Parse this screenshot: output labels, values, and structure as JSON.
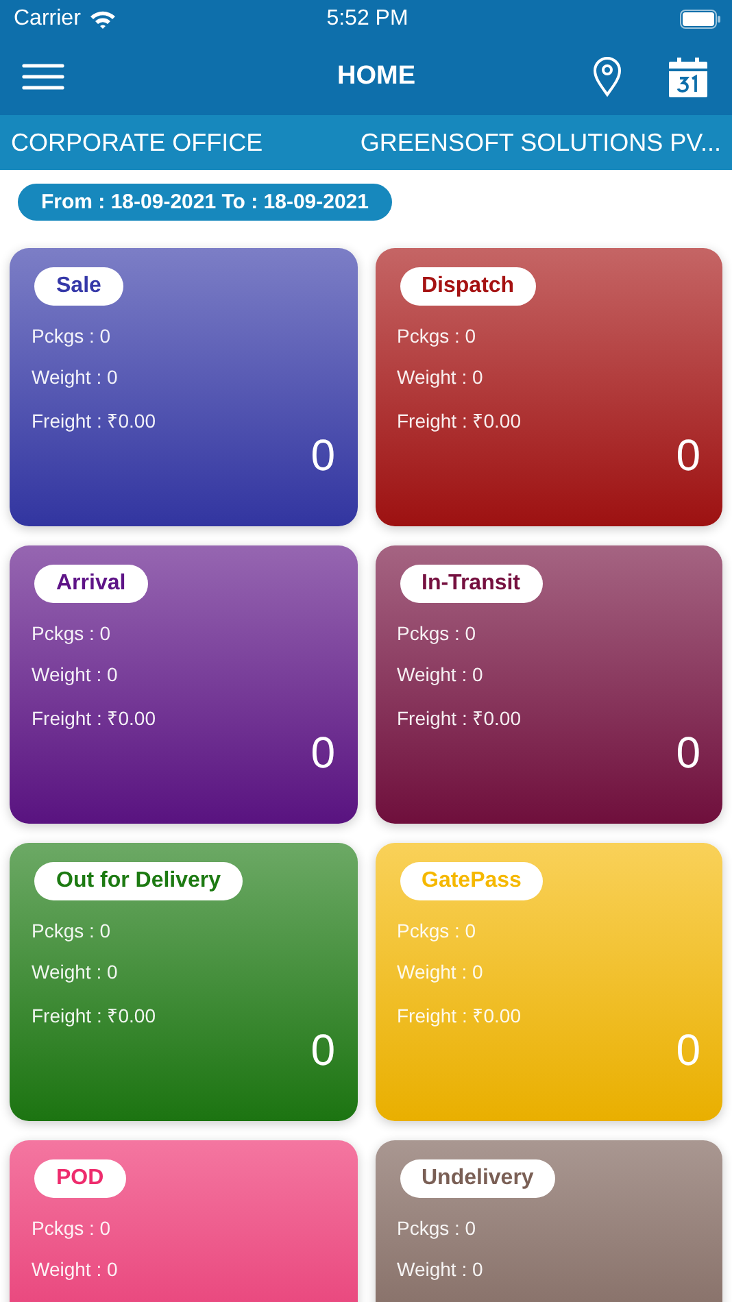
{
  "status_bar": {
    "carrier": "Carrier",
    "time": "5:52 PM"
  },
  "nav_bar": {
    "title": "HOME"
  },
  "branch_bar": {
    "branch": "CORPORATE OFFICE",
    "company": "GREENSOFT SOLUTIONS PV..."
  },
  "date_range": "From : 18-09-2021 To : 18-09-2021",
  "cards": [
    {
      "label": "Sale",
      "color": "#3538a8",
      "lines": [
        "Pckgs : 0",
        "Weight : 0",
        "Freight : ₹0.00"
      ],
      "count": "0"
    },
    {
      "label": "Dispatch",
      "color": "#a51212",
      "lines": [
        "Pckgs : 0",
        "Weight : 0",
        "Freight : ₹0.00"
      ],
      "count": "0"
    },
    {
      "label": "Arrival",
      "color": "#5e1487",
      "lines": [
        "Pckgs : 0",
        "Weight : 0",
        "Freight : ₹0.00"
      ],
      "count": "0"
    },
    {
      "label": "In-Transit",
      "color": "#75103f",
      "lines": [
        "Pckgs : 0",
        "Weight : 0",
        "Freight : ₹0.00"
      ],
      "count": "0"
    },
    {
      "label": "Out for Delivery",
      "color": "#1d7a12",
      "lines": [
        "Pckgs : 0",
        "Weight : 0",
        "Freight : ₹0.00"
      ],
      "count": "0"
    },
    {
      "label": "GatePass",
      "color": "#f5b800",
      "lines": [
        "Pckgs : 0",
        "Weight : 0",
        "Freight : ₹0.00"
      ],
      "count": "0"
    },
    {
      "label": "POD",
      "color": "#ee2c6d",
      "lines": [
        "Pckgs : 0",
        "Weight : 0"
      ]
    },
    {
      "label": "Undelivery",
      "color": "#7a5f55",
      "lines": [
        "Pckgs : 0",
        "Weight : 0"
      ]
    }
  ]
}
